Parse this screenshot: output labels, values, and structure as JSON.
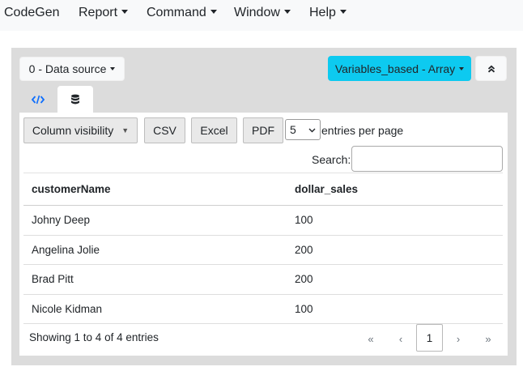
{
  "navbar": {
    "brand": "CodeGen",
    "menu": [
      "Report",
      "Command",
      "Window",
      "Help"
    ]
  },
  "panel": {
    "datasource_label": "0 - Data source",
    "variables_label": "Variables_based - Array",
    "collapse_icon": "chevron-double-up-icon",
    "tabs": [
      {
        "icon": "code-icon",
        "active": false,
        "color": "#0d6efd"
      },
      {
        "icon": "database-icon",
        "active": true
      }
    ]
  },
  "toolbar": {
    "column_visibility": "Column visibility",
    "csv": "CSV",
    "excel": "Excel",
    "pdf": "PDF",
    "page_size": "5",
    "entries_per_page": "entries per page",
    "search_label": "Search:",
    "search_value": ""
  },
  "table": {
    "columns": [
      "customerName",
      "dollar_sales"
    ],
    "rows": [
      [
        "Johny Deep",
        "100"
      ],
      [
        "Angelina Jolie",
        "200"
      ],
      [
        "Brad Pitt",
        "200"
      ],
      [
        "Nicole Kidman",
        "100"
      ]
    ]
  },
  "footer": {
    "info": "Showing 1 to 4 of 4 entries",
    "first": "«",
    "prev": "‹",
    "current_page": "1",
    "next": "›",
    "last": "»"
  },
  "colors": {
    "accent": "#0dcaf0",
    "link": "#0d6efd",
    "panel_bg": "#dcdcdc"
  }
}
